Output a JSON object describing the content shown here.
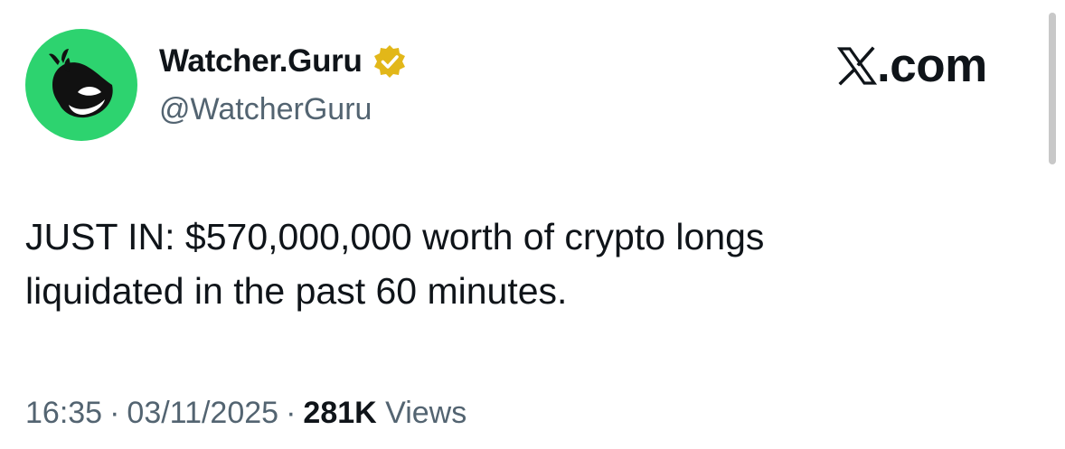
{
  "author": {
    "display_name": "Watcher.Guru",
    "handle": "@WatcherGuru",
    "verified": true,
    "verified_badge_color": "#e2b719",
    "avatar_icon": "whale-icon",
    "avatar_color": "#2dd36f"
  },
  "brand": {
    "icon": "x-logo-icon",
    "text": ".com"
  },
  "post": {
    "text": "JUST IN: $570,000,000 worth of crypto longs\nliquidated in the past 60 minutes."
  },
  "meta": {
    "time": "16:35",
    "separator": "·",
    "date": "03/11/2025",
    "views_count": "281K",
    "views_label": "Views"
  },
  "colors": {
    "text_primary": "#0f1419",
    "text_secondary": "#536471",
    "background": "#ffffff"
  }
}
